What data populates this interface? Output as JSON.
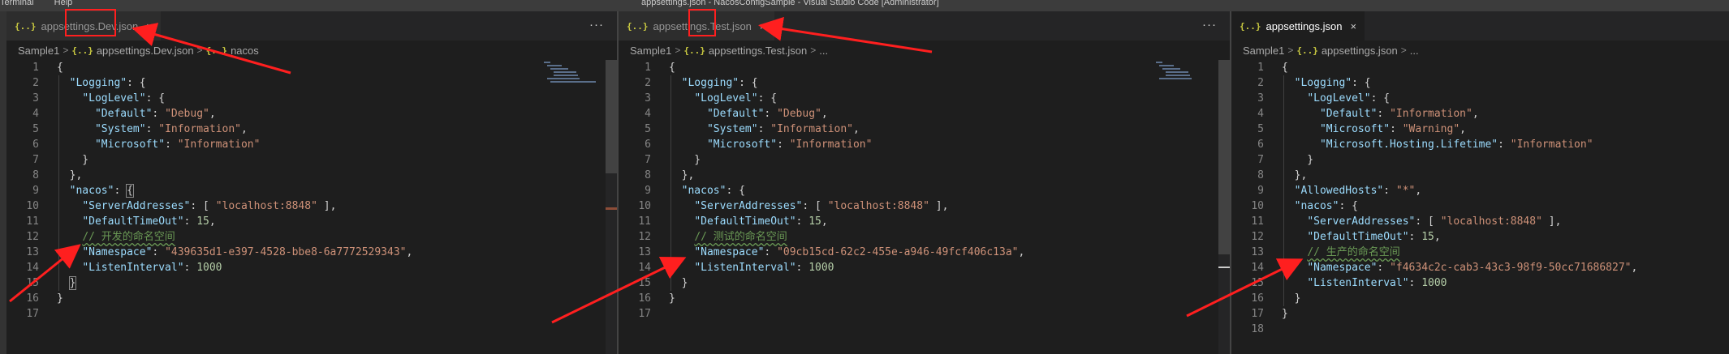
{
  "titlebar": {
    "menu": [
      "Terminal",
      "Help"
    ],
    "title": "appsettings.json - NacosConfigSample - Visual Studio Code [Administrator]"
  },
  "icons": {
    "json": "{..}",
    "close": "×",
    "more": "···",
    "chevron": ">"
  },
  "panes": [
    {
      "tab": "appsettings.Dev.json",
      "breadcrumb": [
        "Sample1",
        "appsettings.Dev.json",
        "nacos"
      ],
      "lines": [
        {
          "n": "1",
          "t": [
            [
              "p",
              "{"
            ]
          ]
        },
        {
          "n": "2",
          "t": [
            [
              "p",
              "  "
            ],
            [
              "k",
              "\"Logging\""
            ],
            [
              "p",
              ": {"
            ]
          ]
        },
        {
          "n": "3",
          "t": [
            [
              "p",
              "    "
            ],
            [
              "k",
              "\"LogLevel\""
            ],
            [
              "p",
              ": {"
            ]
          ]
        },
        {
          "n": "4",
          "t": [
            [
              "p",
              "      "
            ],
            [
              "k",
              "\"Default\""
            ],
            [
              "p",
              ": "
            ],
            [
              "s",
              "\"Debug\""
            ],
            [
              "p",
              ","
            ]
          ]
        },
        {
          "n": "5",
          "t": [
            [
              "p",
              "      "
            ],
            [
              "k",
              "\"System\""
            ],
            [
              "p",
              ": "
            ],
            [
              "s",
              "\"Information\""
            ],
            [
              "p",
              ","
            ]
          ]
        },
        {
          "n": "6",
          "t": [
            [
              "p",
              "      "
            ],
            [
              "k",
              "\"Microsoft\""
            ],
            [
              "p",
              ": "
            ],
            [
              "s",
              "\"Information\""
            ]
          ]
        },
        {
          "n": "7",
          "t": [
            [
              "p",
              "    }"
            ]
          ]
        },
        {
          "n": "8",
          "t": [
            [
              "p",
              "  },"
            ]
          ]
        },
        {
          "n": "9",
          "t": [
            [
              "p",
              "  "
            ],
            [
              "k",
              "\"nacos\""
            ],
            [
              "p",
              ": "
            ],
            [
              "bm",
              "{"
            ]
          ]
        },
        {
          "n": "10",
          "t": [
            [
              "p",
              "    "
            ],
            [
              "k",
              "\"ServerAddresses\""
            ],
            [
              "p",
              ": [ "
            ],
            [
              "s",
              "\"localhost:8848\""
            ],
            [
              "p",
              " ],"
            ]
          ]
        },
        {
          "n": "11",
          "t": [
            [
              "p",
              "    "
            ],
            [
              "k",
              "\"DefaultTimeOut\""
            ],
            [
              "p",
              ": "
            ],
            [
              "n",
              "15"
            ],
            [
              "p",
              ","
            ]
          ]
        },
        {
          "n": "12",
          "t": [
            [
              "p",
              "    "
            ],
            [
              "c",
              "// 开发的命名空间"
            ]
          ]
        },
        {
          "n": "13",
          "t": [
            [
              "p",
              "    "
            ],
            [
              "k",
              "\"Namespace\""
            ],
            [
              "p",
              ": "
            ],
            [
              "s",
              "\"439635d1-e397-4528-bbe8-6a7772529343\""
            ],
            [
              "p",
              ","
            ]
          ]
        },
        {
          "n": "14",
          "t": [
            [
              "p",
              "    "
            ],
            [
              "k",
              "\"ListenInterval\""
            ],
            [
              "p",
              ": "
            ],
            [
              "n",
              "1000"
            ]
          ]
        },
        {
          "n": "15",
          "t": [
            [
              "p",
              "  "
            ],
            [
              "bm",
              "}"
            ]
          ]
        },
        {
          "n": "16",
          "t": [
            [
              "p",
              "}"
            ]
          ]
        },
        {
          "n": "17",
          "t": []
        }
      ]
    },
    {
      "tab": "appsettings.Test.json",
      "breadcrumb": [
        "Sample1",
        "appsettings.Test.json",
        "..."
      ],
      "lines": [
        {
          "n": "1",
          "t": [
            [
              "p",
              "{"
            ]
          ]
        },
        {
          "n": "2",
          "t": [
            [
              "p",
              "  "
            ],
            [
              "k",
              "\"Logging\""
            ],
            [
              "p",
              ": {"
            ]
          ]
        },
        {
          "n": "3",
          "t": [
            [
              "p",
              "    "
            ],
            [
              "k",
              "\"LogLevel\""
            ],
            [
              "p",
              ": {"
            ]
          ]
        },
        {
          "n": "4",
          "t": [
            [
              "p",
              "      "
            ],
            [
              "k",
              "\"Default\""
            ],
            [
              "p",
              ": "
            ],
            [
              "s",
              "\"Debug\""
            ],
            [
              "p",
              ","
            ]
          ]
        },
        {
          "n": "5",
          "t": [
            [
              "p",
              "      "
            ],
            [
              "k",
              "\"System\""
            ],
            [
              "p",
              ": "
            ],
            [
              "s",
              "\"Information\""
            ],
            [
              "p",
              ","
            ]
          ]
        },
        {
          "n": "6",
          "t": [
            [
              "p",
              "      "
            ],
            [
              "k",
              "\"Microsoft\""
            ],
            [
              "p",
              ": "
            ],
            [
              "s",
              "\"Information\""
            ]
          ]
        },
        {
          "n": "7",
          "t": [
            [
              "p",
              "    }"
            ]
          ]
        },
        {
          "n": "8",
          "t": [
            [
              "p",
              "  },"
            ]
          ]
        },
        {
          "n": "9",
          "t": [
            [
              "p",
              "  "
            ],
            [
              "k",
              "\"nacos\""
            ],
            [
              "p",
              ": {"
            ]
          ]
        },
        {
          "n": "10",
          "t": [
            [
              "p",
              "    "
            ],
            [
              "k",
              "\"ServerAddresses\""
            ],
            [
              "p",
              ": [ "
            ],
            [
              "s",
              "\"localhost:8848\""
            ],
            [
              "p",
              " ],"
            ]
          ]
        },
        {
          "n": "11",
          "t": [
            [
              "p",
              "    "
            ],
            [
              "k",
              "\"DefaultTimeOut\""
            ],
            [
              "p",
              ": "
            ],
            [
              "n",
              "15"
            ],
            [
              "p",
              ","
            ]
          ]
        },
        {
          "n": "12",
          "t": [
            [
              "p",
              "    "
            ],
            [
              "c",
              "// 测试的命名空间"
            ]
          ]
        },
        {
          "n": "13",
          "t": [
            [
              "p",
              "    "
            ],
            [
              "k",
              "\"Namespace\""
            ],
            [
              "p",
              ": "
            ],
            [
              "s",
              "\"09cb15cd-62c2-455e-a946-49fcf406c13a\""
            ],
            [
              "p",
              ","
            ]
          ]
        },
        {
          "n": "14",
          "t": [
            [
              "p",
              "    "
            ],
            [
              "k",
              "\"ListenInterval\""
            ],
            [
              "p",
              ": "
            ],
            [
              "n",
              "1000"
            ]
          ]
        },
        {
          "n": "15",
          "t": [
            [
              "p",
              "  }"
            ]
          ]
        },
        {
          "n": "16",
          "t": [
            [
              "p",
              "}"
            ]
          ]
        },
        {
          "n": "17",
          "t": []
        }
      ]
    },
    {
      "tab": "appsettings.json",
      "breadcrumb": [
        "Sample1",
        "appsettings.json",
        "..."
      ],
      "lines": [
        {
          "n": "1",
          "t": [
            [
              "p",
              "{"
            ]
          ]
        },
        {
          "n": "2",
          "t": [
            [
              "p",
              "  "
            ],
            [
              "k",
              "\"Logging\""
            ],
            [
              "p",
              ": {"
            ]
          ]
        },
        {
          "n": "3",
          "t": [
            [
              "p",
              "    "
            ],
            [
              "k",
              "\"LogLevel\""
            ],
            [
              "p",
              ": {"
            ]
          ]
        },
        {
          "n": "4",
          "t": [
            [
              "p",
              "      "
            ],
            [
              "k",
              "\"Default\""
            ],
            [
              "p",
              ": "
            ],
            [
              "s",
              "\"Information\""
            ],
            [
              "p",
              ","
            ]
          ]
        },
        {
          "n": "5",
          "t": [
            [
              "p",
              "      "
            ],
            [
              "k",
              "\"Microsoft\""
            ],
            [
              "p",
              ": "
            ],
            [
              "s",
              "\"Warning\""
            ],
            [
              "p",
              ","
            ]
          ]
        },
        {
          "n": "6",
          "t": [
            [
              "p",
              "      "
            ],
            [
              "k",
              "\"Microsoft.Hosting.Lifetime\""
            ],
            [
              "p",
              ": "
            ],
            [
              "s",
              "\"Information\""
            ]
          ]
        },
        {
          "n": "7",
          "t": [
            [
              "p",
              "    }"
            ]
          ]
        },
        {
          "n": "8",
          "t": [
            [
              "p",
              "  },"
            ]
          ]
        },
        {
          "n": "9",
          "t": [
            [
              "p",
              "  "
            ],
            [
              "k",
              "\"AllowedHosts\""
            ],
            [
              "p",
              ": "
            ],
            [
              "s",
              "\"*\""
            ],
            [
              "p",
              ","
            ]
          ]
        },
        {
          "n": "10",
          "t": [
            [
              "p",
              "  "
            ],
            [
              "k",
              "\"nacos\""
            ],
            [
              "p",
              ": {"
            ]
          ]
        },
        {
          "n": "11",
          "t": [
            [
              "p",
              "    "
            ],
            [
              "k",
              "\"ServerAddresses\""
            ],
            [
              "p",
              ": [ "
            ],
            [
              "s",
              "\"localhost:8848\""
            ],
            [
              "p",
              " ],"
            ]
          ]
        },
        {
          "n": "12",
          "t": [
            [
              "p",
              "    "
            ],
            [
              "k",
              "\"DefaultTimeOut\""
            ],
            [
              "p",
              ": "
            ],
            [
              "n",
              "15"
            ],
            [
              "p",
              ","
            ]
          ]
        },
        {
          "n": "13",
          "t": [
            [
              "p",
              "    "
            ],
            [
              "c",
              "// 生产的命名空间"
            ]
          ]
        },
        {
          "n": "14",
          "t": [
            [
              "p",
              "    "
            ],
            [
              "k",
              "\"Namespace\""
            ],
            [
              "p",
              ": "
            ],
            [
              "s",
              "\"f4634c2c-cab3-43c3-98f9-50cc71686827\""
            ],
            [
              "p",
              ","
            ]
          ]
        },
        {
          "n": "15",
          "t": [
            [
              "p",
              "    "
            ],
            [
              "k",
              "\"ListenInterval\""
            ],
            [
              "p",
              ": "
            ],
            [
              "n",
              "1000"
            ]
          ]
        },
        {
          "n": "16",
          "t": [
            [
              "p",
              "  }"
            ]
          ]
        },
        {
          "n": "17",
          "t": [
            [
              "p",
              "}"
            ]
          ]
        },
        {
          "n": "18",
          "t": []
        }
      ]
    }
  ]
}
